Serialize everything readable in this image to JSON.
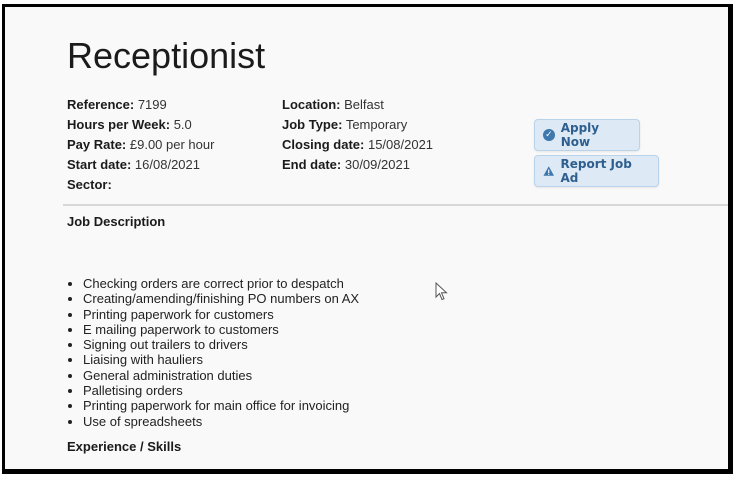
{
  "job": {
    "title": "Receptionist",
    "reference_label": "Reference:",
    "reference": "7199",
    "hours_label": "Hours per Week:",
    "hours": "5.0",
    "pay_label": "Pay Rate:",
    "pay": "£9.00 per hour",
    "start_label": "Start date:",
    "start": "16/08/2021",
    "sector_label": "Sector:",
    "sector": "",
    "location_label": "Location:",
    "location": "Belfast",
    "type_label": "Job Type:",
    "type": "Temporary",
    "closing_label": "Closing date:",
    "closing": "15/08/2021",
    "end_label": "End date:",
    "end": "30/09/2021"
  },
  "actions": {
    "apply_label": "Apply Now",
    "report_label": "Report Job Ad",
    "apply_icon": "check-circle-icon",
    "report_icon": "warning-icon",
    "accent_color": "#2f5f8f"
  },
  "description": {
    "heading": "Job Description",
    "duties": [
      "Checking orders are correct prior to despatch",
      "Creating/amending/finishing PO numbers on AX",
      "Printing paperwork for customers",
      "E mailing paperwork to customers",
      "Signing out trailers to drivers",
      "Liaising with hauliers",
      "General administration duties",
      "Palletising orders",
      "Printing paperwork for main office for invoicing",
      "Use of spreadsheets"
    ]
  },
  "skills": {
    "heading": "Experience / Skills"
  }
}
